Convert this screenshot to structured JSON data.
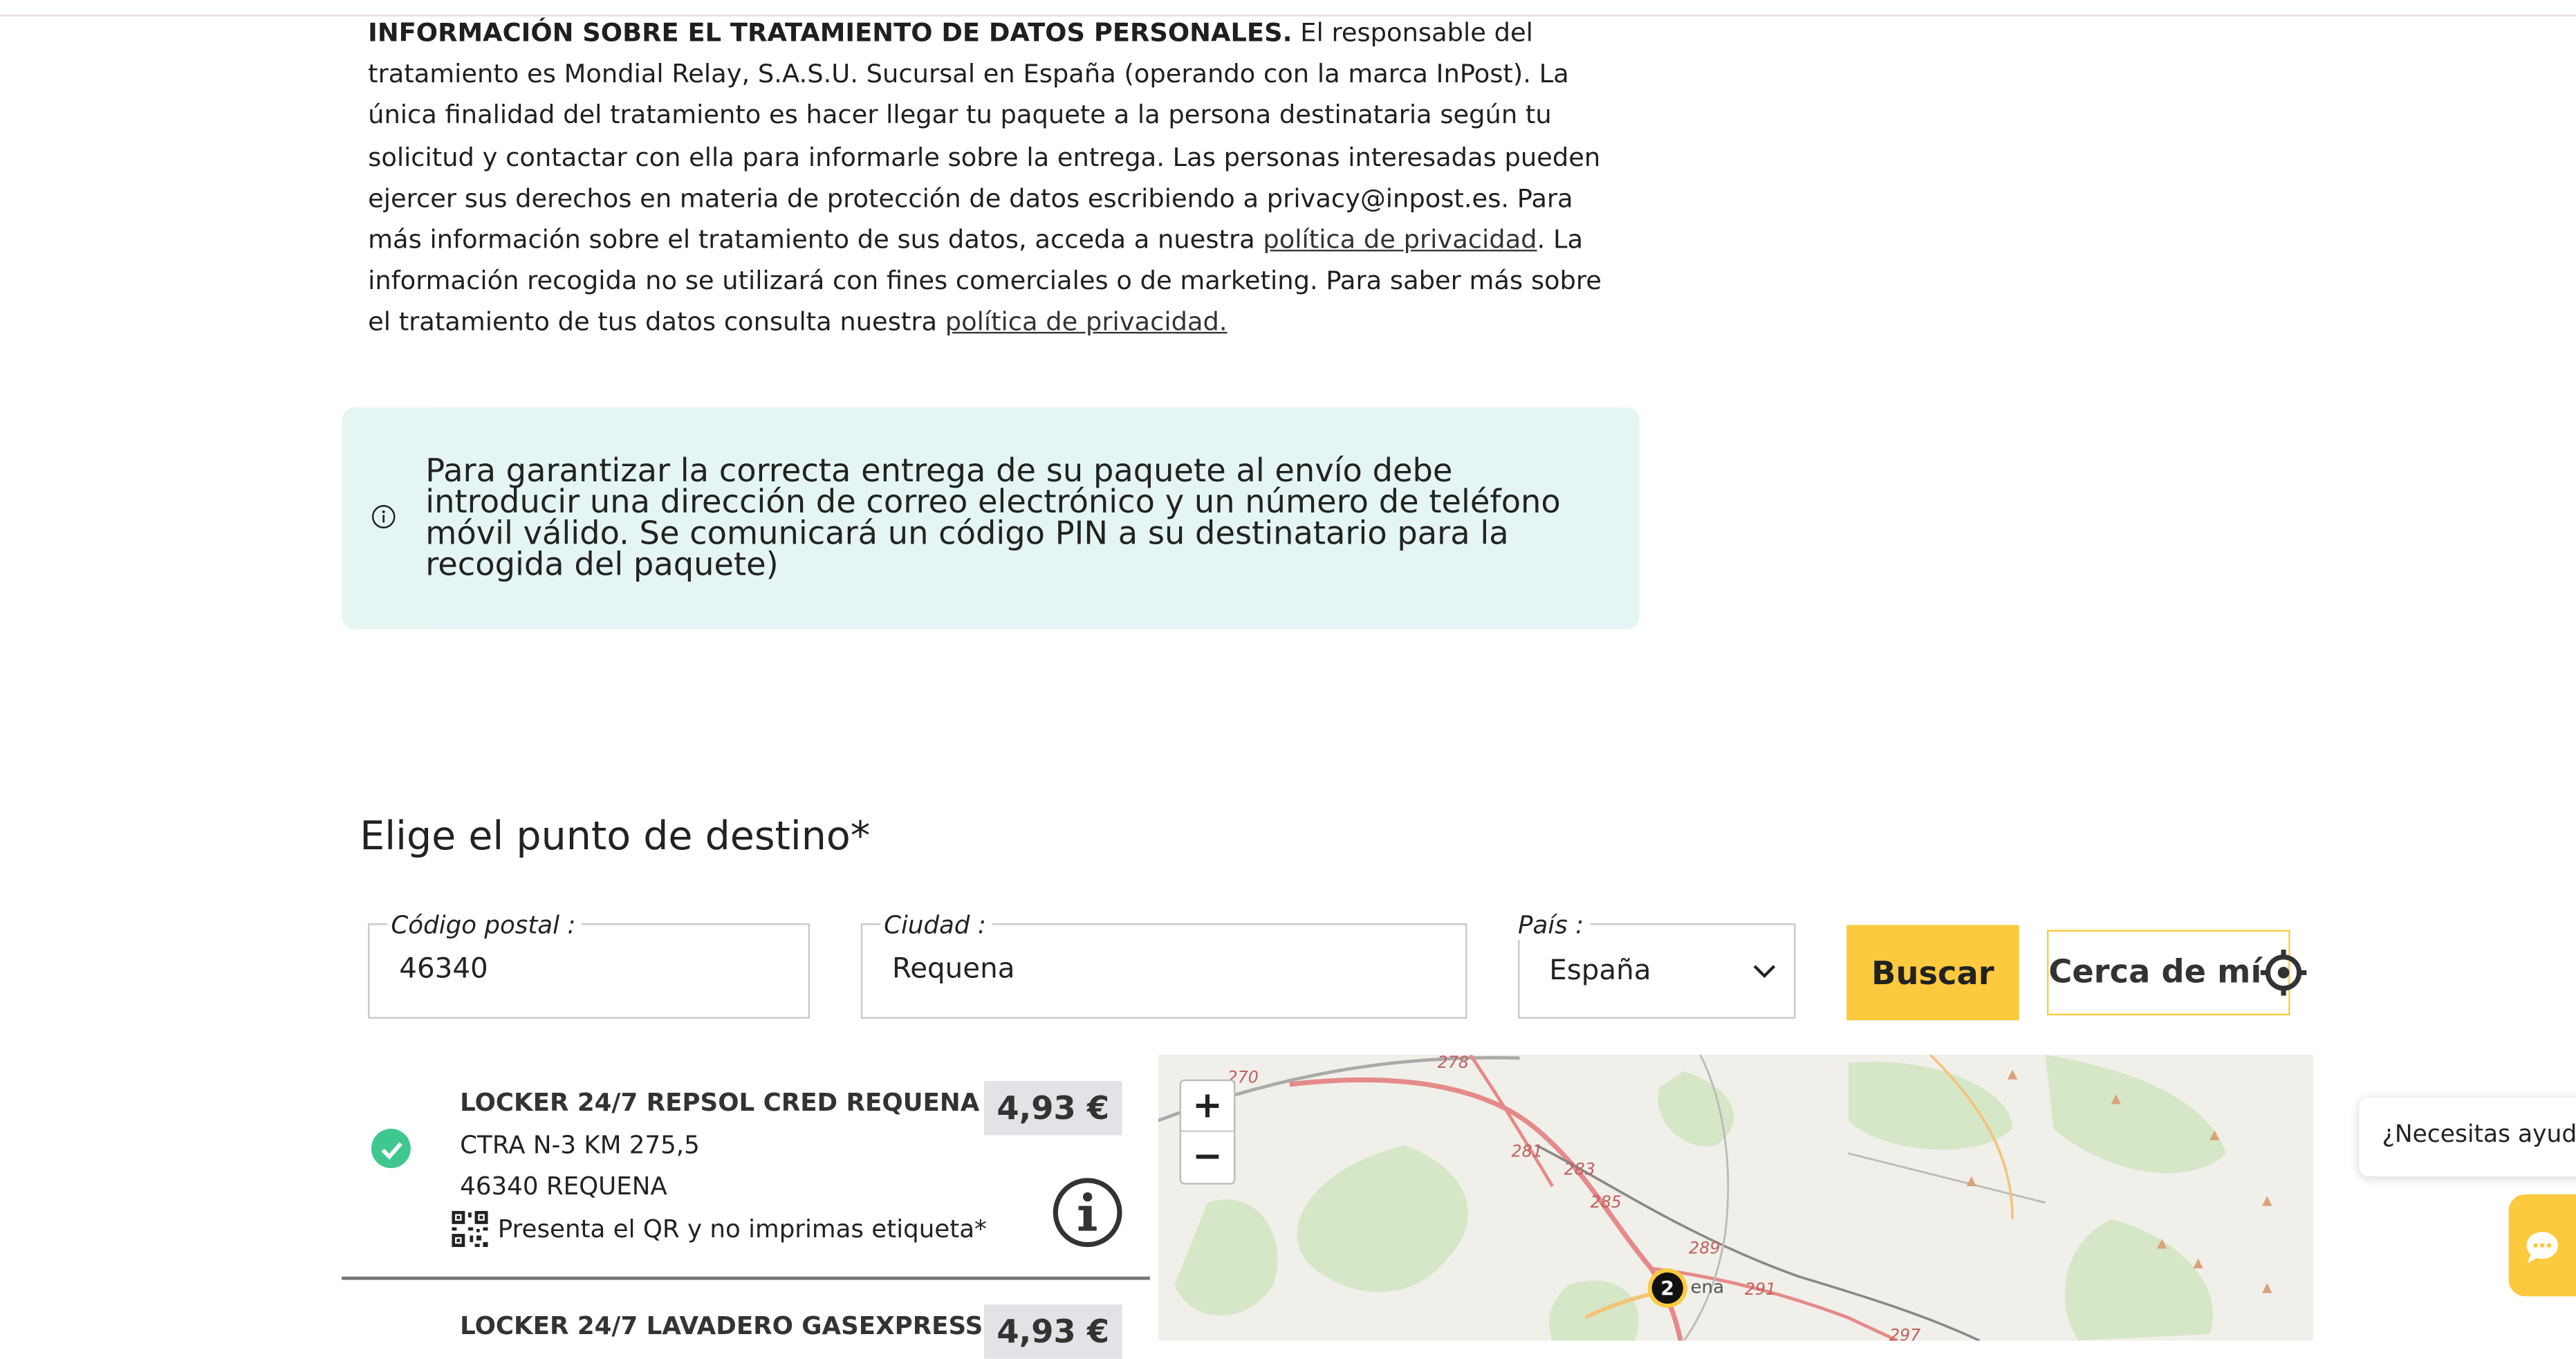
{
  "privacy": {
    "bold_heading": "INFORMACIÓN SOBRE EL TRATAMIENTO DE DATOS PERSONALES.",
    "text_1": " El responsable del tratamiento es Mondial Relay, S.A.S.U. Sucursal en España (operando con la marca InPost). La única finalidad del tratamiento es hacer llegar tu paquete a la persona destinataria según tu solicitud y contactar con ella para informarle sobre la entrega. Las personas interesadas pueden ejercer sus derechos en materia de protección de datos escribiendo a privacy@inpost.es. Para más información sobre el tratamiento de sus datos, acceda a nuestra ",
    "link_1": "política de privacidad",
    "text_2": ". La información recogida no se utilizará con fines comerciales o de marketing. Para saber más sobre el tratamiento de tus datos consulta nuestra ",
    "link_2": "política de privacidad."
  },
  "notice": {
    "text": "Para garantizar la correcta entrega de su paquete al envío debe introducir una dirección de correo electrónico y un número de teléfono móvil válido. Se comunicará un código PIN a su destinatario para la recogida del paquete)",
    "icon": "info-circle-icon"
  },
  "destination": {
    "title": "Elige el punto de destino*",
    "postal_label": "Código postal :",
    "postal_value": "46340",
    "city_label": "Ciudad :",
    "city_value": "Requena",
    "country_label": "País :",
    "country_value": "España",
    "search_button": "Buscar",
    "near_me_button": "Cerca de mí"
  },
  "lockers": [
    {
      "name": "LOCKER 24/7 REPSOL CRED REQUENA",
      "address": "CTRA N-3 KM 275,5",
      "city": "46340 REQUENA",
      "qr_note": "Presenta el QR y no imprimas etiqueta*",
      "price": "4,93 €",
      "selected": true
    },
    {
      "name": "LOCKER 24/7 LAVADERO GASEXPRESS",
      "price": "4,93 €"
    }
  ],
  "map": {
    "zoom_in": "+",
    "zoom_out": "−",
    "cluster_count": "2",
    "place_label": "ena",
    "km_labels": [
      "270",
      "278",
      "281",
      "283",
      "285",
      "289",
      "291",
      "297"
    ]
  },
  "help": {
    "bubble_text": "¿Necesitas ayuda?"
  },
  "colors": {
    "accent": "#fcca3e",
    "notice_bg": "#e5f5f4",
    "check": "#3fc78f",
    "price_bg": "#e2e3e7"
  }
}
